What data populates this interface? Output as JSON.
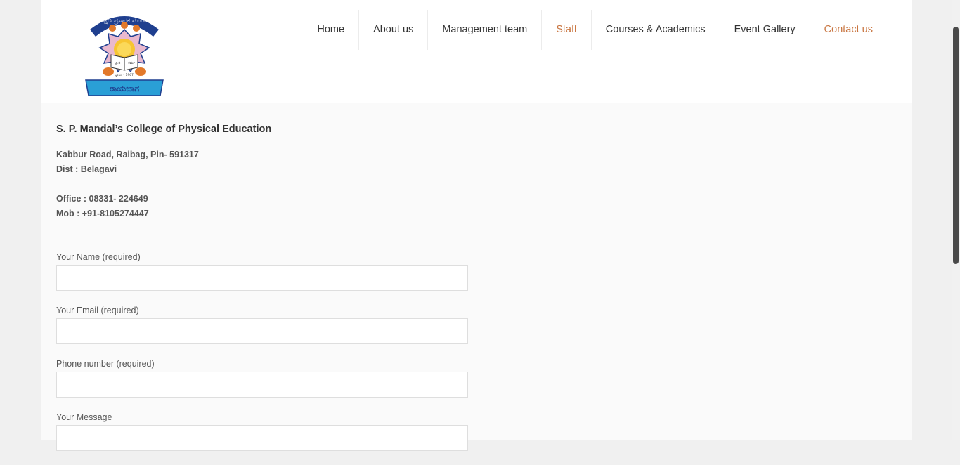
{
  "logo": {
    "arc_text": "ಶಿಕ್ಷಣ ಪ್ರಸಾರಕ ಮಂಡಳ",
    "banner_text": "ರಾಯಬಾಗ",
    "book_left": "ಜ್ಞಾನ",
    "book_right": "ಕರ್ಮ",
    "year": "ಸ್ಥಾಪನೆ - 1967"
  },
  "nav": {
    "items": [
      {
        "label": "Home"
      },
      {
        "label": "About us"
      },
      {
        "label": "Management team"
      },
      {
        "label": "Staff"
      },
      {
        "label": "Courses & Academics"
      },
      {
        "label": "Event Gallery"
      },
      {
        "label": "Contact us"
      }
    ]
  },
  "contact": {
    "college_name": "S. P. Mandal’s College of Physical Education",
    "address_line1": "Kabbur Road, Raibag, Pin- 591317",
    "address_line2": "Dist : Belagavi",
    "office": "Office : 08331- 224649",
    "mobile": "Mob : +91-8105274447"
  },
  "form": {
    "name_label": "Your Name (required)",
    "name_value": "",
    "email_label": "Your Email (required)",
    "email_value": "",
    "phone_label": "Phone number (required)",
    "phone_value": "",
    "message_label": "Your Message",
    "message_value": ""
  },
  "colors": {
    "accent": "#c8743f",
    "logo_blue": "#1f3f8f",
    "logo_orange": "#e2792a"
  }
}
